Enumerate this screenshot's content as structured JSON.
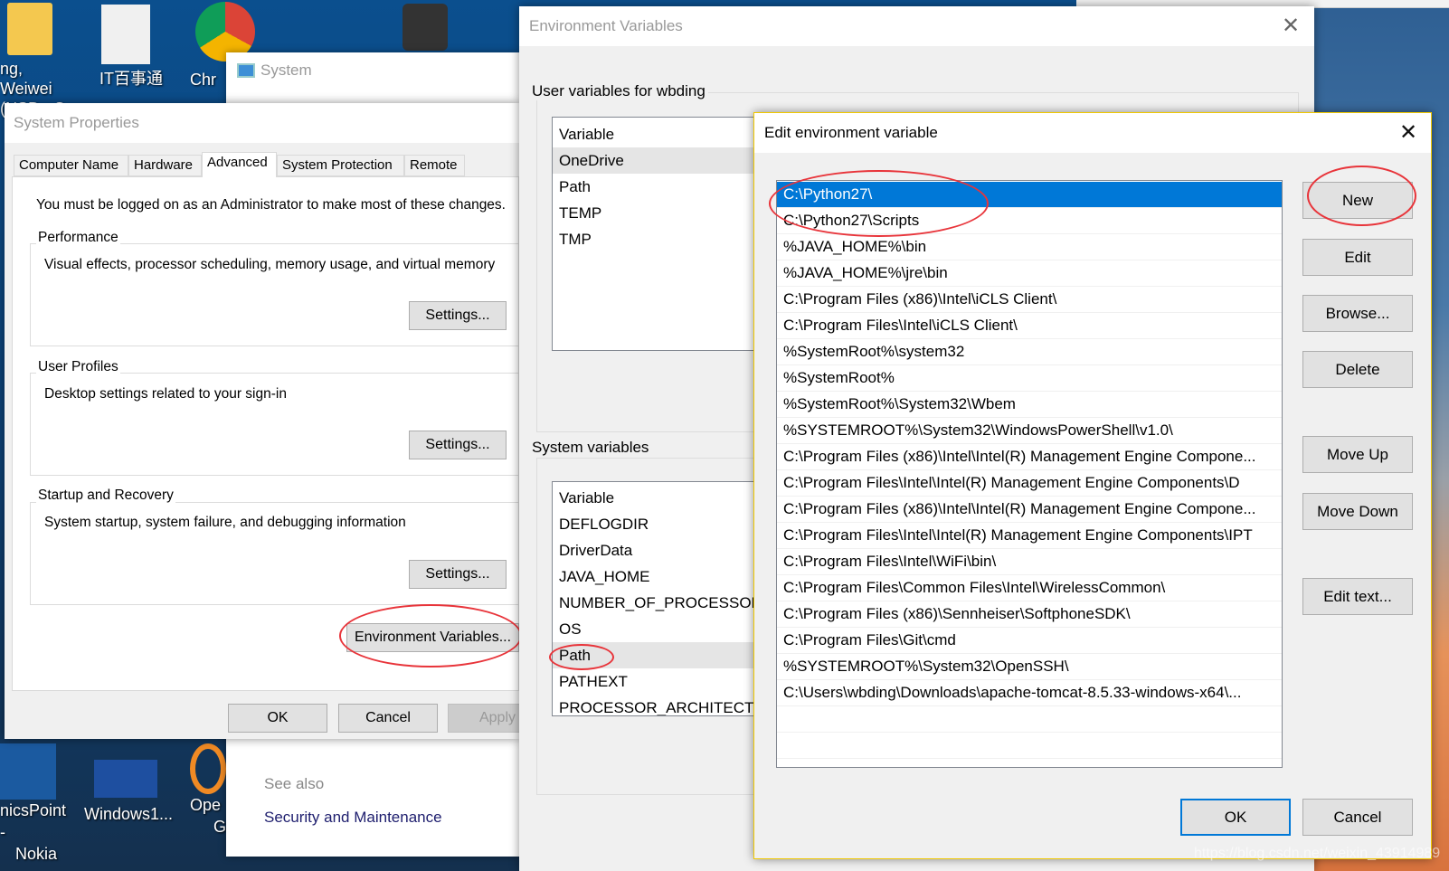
{
  "desktop": {
    "top_icons": [
      {
        "label": "ng, Weiwei",
        "label2": "(NSB - C"
      },
      {
        "label": "IT百事通"
      },
      {
        "label": "Chr"
      }
    ],
    "bottom_icons": [
      {
        "label": "nicsPoint -",
        "label2": "Nokia"
      },
      {
        "label": "Windows1..."
      },
      {
        "label": "Ope",
        "label2": "G"
      }
    ],
    "watermark": "https://blog.csdn.net/weixin_43914989"
  },
  "system_window": {
    "title": "System",
    "see_also": "See also",
    "link": "Security and Maintenance"
  },
  "system_properties": {
    "title": "System Properties",
    "tabs": [
      "Computer Name",
      "Hardware",
      "Advanced",
      "System Protection",
      "Remote"
    ],
    "active_tab": "Advanced",
    "admin_note": "You must be logged on as an Administrator to make most of these changes.",
    "performance": {
      "label": "Performance",
      "desc": "Visual effects, processor scheduling, memory usage, and virtual memory",
      "button": "Settings..."
    },
    "user_profiles": {
      "label": "User Profiles",
      "desc": "Desktop settings related to your sign-in",
      "button": "Settings..."
    },
    "startup": {
      "label": "Startup and Recovery",
      "desc": "System startup, system failure, and debugging information",
      "button": "Settings..."
    },
    "env_button": "Environment Variables...",
    "ok": "OK",
    "cancel": "Cancel",
    "apply": "Apply"
  },
  "env_vars": {
    "title": "Environment Variables",
    "user_group": "User variables for wbding",
    "user_header": "Variable",
    "user_rows": [
      "OneDrive",
      "Path",
      "TEMP",
      "TMP"
    ],
    "system_group": "System variables",
    "system_header": "Variable",
    "system_rows": [
      "DEFLOGDIR",
      "DriverData",
      "JAVA_HOME",
      "NUMBER_OF_PROCESSORS",
      "OS",
      "Path",
      "PATHEXT",
      "PROCESSOR_ARCHITECTURE"
    ]
  },
  "edit_dialog": {
    "title": "Edit environment variable",
    "entries": [
      "C:\\Python27\\",
      "C:\\Python27\\Scripts",
      "%JAVA_HOME%\\bin",
      "%JAVA_HOME%\\jre\\bin",
      "C:\\Program Files (x86)\\Intel\\iCLS Client\\",
      "C:\\Program Files\\Intel\\iCLS Client\\",
      "%SystemRoot%\\system32",
      "%SystemRoot%",
      "%SystemRoot%\\System32\\Wbem",
      "%SYSTEMROOT%\\System32\\WindowsPowerShell\\v1.0\\",
      "C:\\Program Files (x86)\\Intel\\Intel(R) Management Engine Compone...",
      "C:\\Program Files\\Intel\\Intel(R) Management Engine Components\\D",
      "C:\\Program Files (x86)\\Intel\\Intel(R) Management Engine Compone...",
      "C:\\Program Files\\Intel\\Intel(R) Management Engine Components\\IPT",
      "C:\\Program Files\\Intel\\WiFi\\bin\\",
      "C:\\Program Files\\Common Files\\Intel\\WirelessCommon\\",
      "C:\\Program Files (x86)\\Sennheiser\\SoftphoneSDK\\",
      "C:\\Program Files\\Git\\cmd",
      "%SYSTEMROOT%\\System32\\OpenSSH\\",
      "C:\\Users\\wbding\\Downloads\\apache-tomcat-8.5.33-windows-x64\\..."
    ],
    "selected_index": 0,
    "buttons": {
      "new": "New",
      "edit": "Edit",
      "browse": "Browse...",
      "delete": "Delete",
      "move_up": "Move Up",
      "move_down": "Move Down",
      "edit_text": "Edit text..."
    },
    "ok": "OK",
    "cancel": "Cancel"
  },
  "colors": {
    "selection": "#0078d7",
    "annotation": "#e8343a",
    "dialog_border": "#f0c800"
  }
}
